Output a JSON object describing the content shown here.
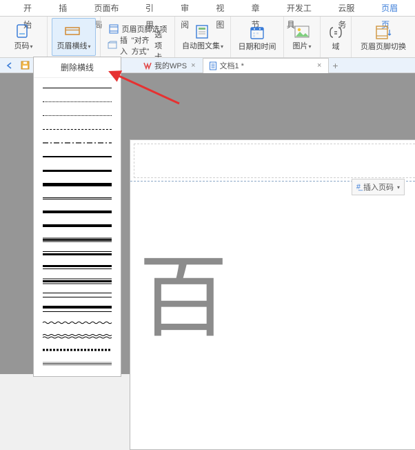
{
  "menu": {
    "items": [
      "开始",
      "插入",
      "页面布局",
      "引用",
      "审阅",
      "视图",
      "章节",
      "开发工具",
      "云服务",
      "页眉页"
    ],
    "activeIndex": 9
  },
  "ribbon": {
    "codeBtn": "页码",
    "headerLineBtn": "页眉横线",
    "hfOptions": "页眉页脚选项",
    "insert": "插入",
    "alignMode": "\"对齐方式\"",
    "tabOptions": "选项卡",
    "autoTextBtn": "自动图文集",
    "dateTimeBtn": "日期和时间",
    "pictureBtn": "图片",
    "fieldBtn": "域",
    "switchBtn": "页眉页脚切换"
  },
  "dropdown": {
    "title": "删除横线"
  },
  "tabs": {
    "t1": "我的WPS",
    "t2": "文档1 *"
  },
  "doc": {
    "insertPageNum": "插入页码",
    "char": "百"
  },
  "chart_data": null
}
